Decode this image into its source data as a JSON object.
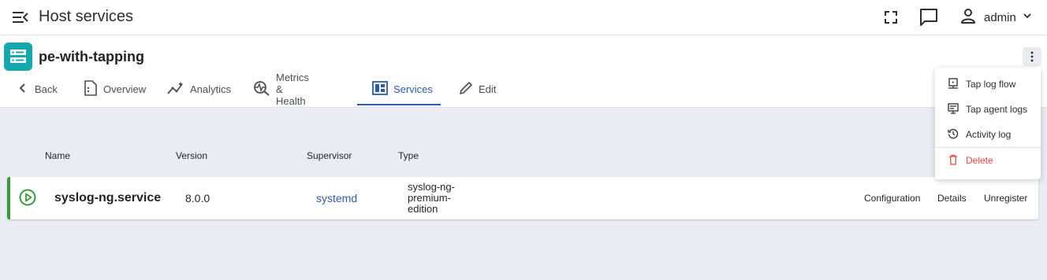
{
  "topbar": {
    "title": "Host services",
    "user": {
      "name": "admin"
    },
    "icons": [
      "menu-collapse-icon",
      "fullscreen-icon",
      "feedback-icon",
      "user-icon",
      "chevron-down-icon"
    ]
  },
  "host": {
    "name": "pe-with-tapping",
    "badge_icon": "server-icon",
    "badge_color": "#16a8ad"
  },
  "tabs": [
    {
      "label": "Back",
      "icon": "chevron-left-icon"
    },
    {
      "label": "Overview",
      "icon": "document-icon"
    },
    {
      "label": "Analytics",
      "icon": "analytics-icon"
    },
    {
      "label": "Metrics & Health",
      "icon": "metrics-icon"
    },
    {
      "label": "Services",
      "icon": "services-icon",
      "active": true
    },
    {
      "label": "Edit",
      "icon": "pencil-icon"
    }
  ],
  "table": {
    "columns": [
      "Name",
      "Version",
      "Supervisor",
      "Type"
    ],
    "rows": [
      {
        "status": "running",
        "status_icon": "play-circle-icon",
        "status_color": "#3a9a3a",
        "name": "syslog-ng.service",
        "version": "8.0.0",
        "supervisor": "systemd",
        "type_lines": [
          "syslog-ng-",
          "premium-",
          "edition"
        ],
        "actions": [
          "Configuration",
          "Details",
          "Unregister"
        ]
      }
    ]
  },
  "menu": {
    "items": [
      {
        "label": "Tap log flow",
        "icon": "tap-flow-icon"
      },
      {
        "label": "Tap agent logs",
        "icon": "agent-logs-icon"
      },
      {
        "label": "Activity log",
        "icon": "history-icon"
      },
      {
        "label": "Delete",
        "icon": "trash-icon",
        "danger": true
      }
    ]
  },
  "colors": {
    "accent": "#2f5ba8",
    "danger": "#e04848",
    "page_bg": "#e9edf3"
  }
}
